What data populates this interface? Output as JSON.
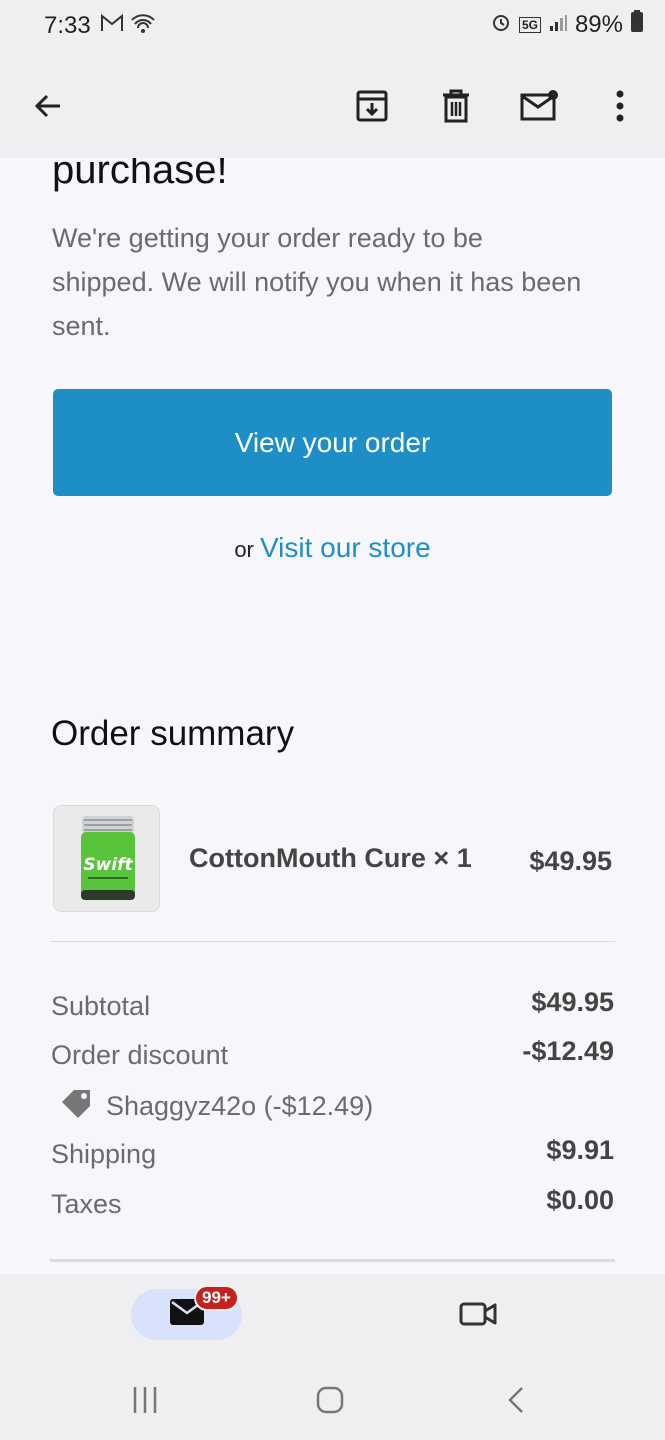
{
  "status_bar": {
    "time": "7:33",
    "network": "5G",
    "battery": "89%",
    "icons": [
      "gmail-icon",
      "wifi-icon",
      "alarm-icon",
      "signal-icon",
      "battery-icon"
    ]
  },
  "toolbar": {
    "icons": [
      "back-arrow-icon",
      "archive-icon",
      "delete-icon",
      "mark-unread-icon",
      "more-vert-icon"
    ]
  },
  "email": {
    "heading_fragment": "purchase!",
    "intro": "We're getting your order ready to be shipped. We will notify you when it has been sent.",
    "view_order_label": "View your order",
    "or_text": "or",
    "visit_store_label": "Visit our store",
    "summary_title": "Order summary",
    "product": {
      "name": "CottonMouth Cure × 1",
      "price": "$49.95"
    },
    "totals": {
      "subtotal_label": "Subtotal",
      "subtotal_value": "$49.95",
      "discount_label": "Order discount",
      "discount_value": "-$12.49",
      "discount_code": "Shaggyz42o (-$12.49)",
      "shipping_label": "Shipping",
      "shipping_value": "$9.91",
      "taxes_label": "Taxes",
      "taxes_value": "$0.00"
    }
  },
  "bottom_nav": {
    "mail_badge": "99+",
    "icons": [
      "mail-icon",
      "video-icon"
    ]
  },
  "system_nav": {
    "icons": [
      "recents-icon",
      "home-icon",
      "back-icon"
    ]
  },
  "colors": {
    "accent": "#1d8fc6",
    "badge": "#c5221f",
    "mail_pill": "#d9e2fb",
    "product_green": "#58c43c"
  }
}
